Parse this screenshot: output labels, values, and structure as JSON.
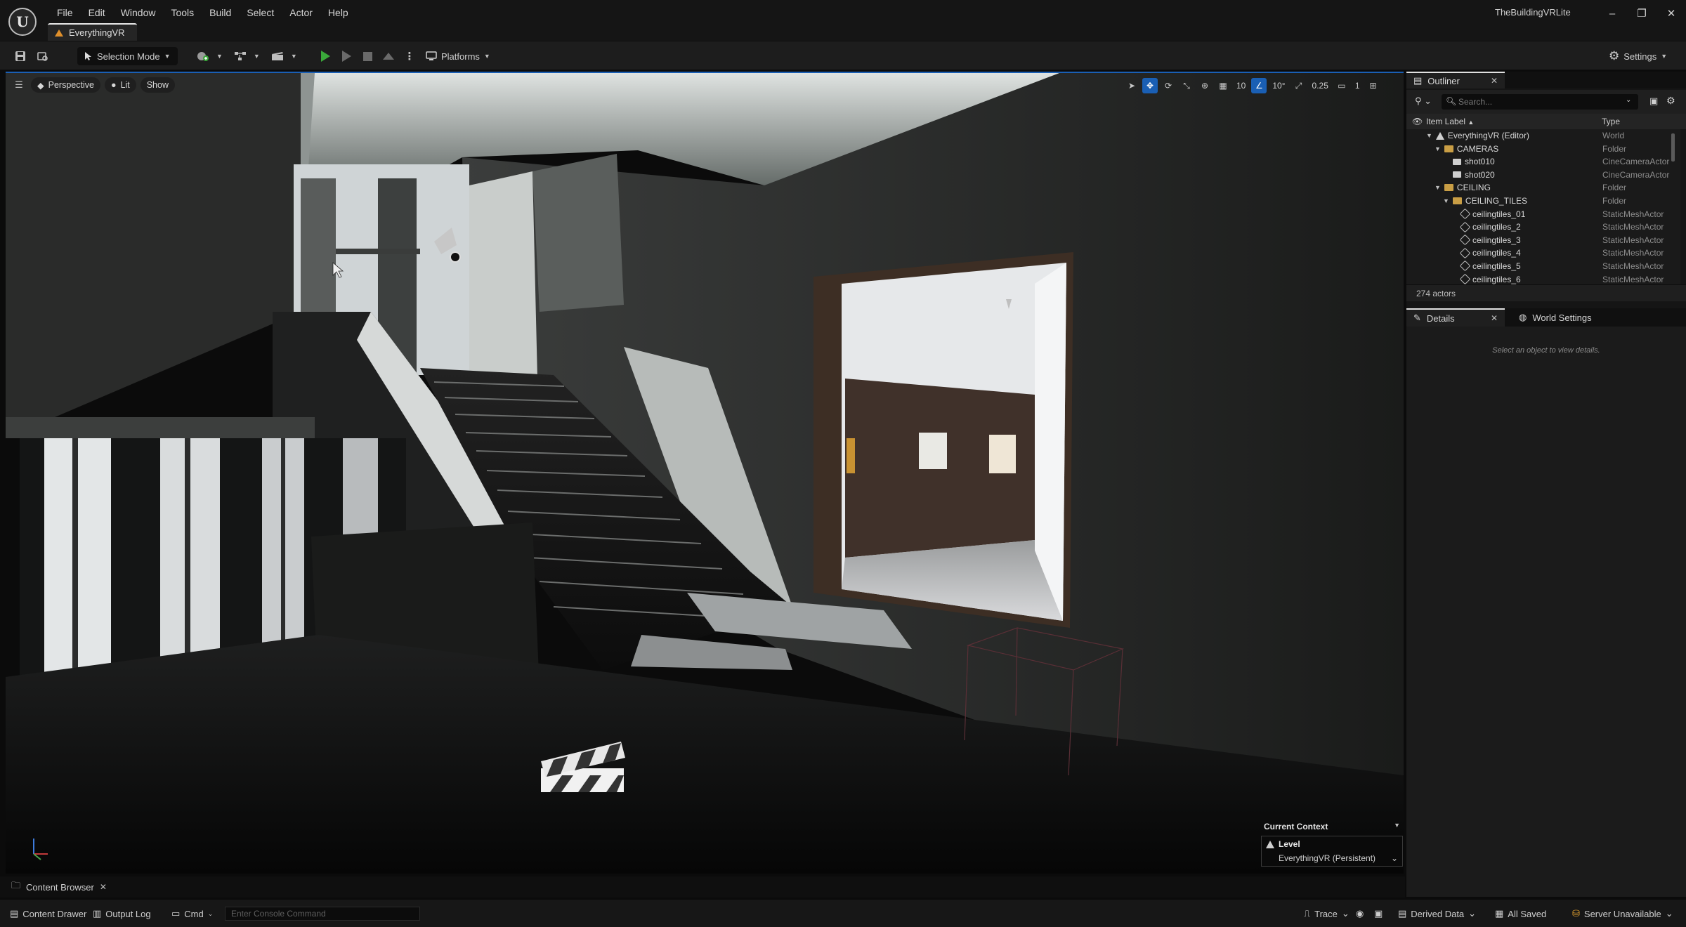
{
  "app": {
    "logo_letter": "U",
    "project_name": "TheBuildingVRLite",
    "document_tab": "EverythingVR"
  },
  "menu": [
    "File",
    "Edit",
    "Window",
    "Tools",
    "Build",
    "Select",
    "Actor",
    "Help"
  ],
  "window_controls": {
    "minimize": "–",
    "restore": "❐",
    "close": "✕"
  },
  "toolbar": {
    "selection_mode": "Selection Mode",
    "platforms": "Platforms",
    "settings": "Settings"
  },
  "viewport": {
    "perspective": "Perspective",
    "lit": "Lit",
    "show": "Show",
    "grid_snap": "10",
    "rotation_snap": "10°",
    "scale_snap": "0.25",
    "camera_speed": "1"
  },
  "current_context": {
    "title": "Current Context",
    "level_label": "Level",
    "level_value": "EverythingVR (Persistent)"
  },
  "outliner": {
    "tab_label": "Outliner",
    "search_placeholder": "Search...",
    "col_item_label": "Item Label",
    "col_type": "Type",
    "rows": [
      {
        "label": "EverythingVR (Editor)",
        "type": "World",
        "indent": 0,
        "icon": "world-icon",
        "expanded": true
      },
      {
        "label": "CAMERAS",
        "type": "Folder",
        "indent": 1,
        "icon": "folder-icon",
        "expanded": true
      },
      {
        "label": "shot010",
        "type": "CineCameraActor",
        "indent": 2,
        "icon": "camera-icon"
      },
      {
        "label": "shot020",
        "type": "CineCameraActor",
        "indent": 2,
        "icon": "camera-icon"
      },
      {
        "label": "CEILING",
        "type": "Folder",
        "indent": 1,
        "icon": "folder-icon",
        "expanded": true
      },
      {
        "label": "CEILING_TILES",
        "type": "Folder",
        "indent": 2,
        "icon": "folder-icon",
        "expanded": true
      },
      {
        "label": "ceilingtiles_01",
        "type": "StaticMeshActor",
        "indent": 3,
        "icon": "static-mesh-icon"
      },
      {
        "label": "ceilingtiles_2",
        "type": "StaticMeshActor",
        "indent": 3,
        "icon": "static-mesh-icon"
      },
      {
        "label": "ceilingtiles_3",
        "type": "StaticMeshActor",
        "indent": 3,
        "icon": "static-mesh-icon"
      },
      {
        "label": "ceilingtiles_4",
        "type": "StaticMeshActor",
        "indent": 3,
        "icon": "static-mesh-icon"
      },
      {
        "label": "ceilingtiles_5",
        "type": "StaticMeshActor",
        "indent": 3,
        "icon": "static-mesh-icon"
      },
      {
        "label": "ceilingtiles_6",
        "type": "StaticMeshActor",
        "indent": 3,
        "icon": "static-mesh-icon"
      }
    ],
    "actor_count": "274 actors"
  },
  "details": {
    "tab_label": "Details",
    "world_settings_label": "World Settings",
    "empty_message": "Select an object to view details."
  },
  "bottom": {
    "content_browser_tab": "Content Browser",
    "content_drawer": "Content Drawer",
    "output_log": "Output Log",
    "cmd": "Cmd",
    "console_placeholder": "Enter Console Command",
    "trace": "Trace",
    "derived_data": "Derived Data",
    "all_saved": "All Saved",
    "server": "Server Unavailable"
  },
  "colors": {
    "accent": "#1a5fb4",
    "play": "#3aa83a",
    "folder": "#c99e45"
  }
}
